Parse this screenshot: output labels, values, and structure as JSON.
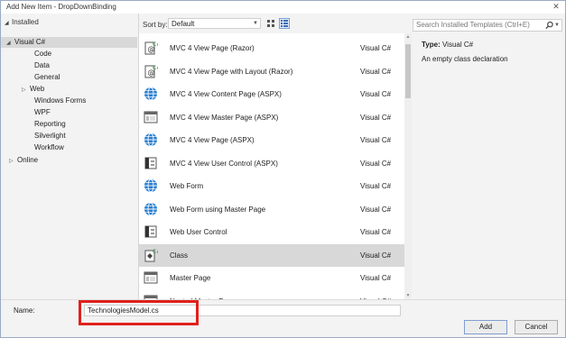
{
  "window": {
    "title": "Add New Item - DropDownBinding",
    "close_glyph": "✕"
  },
  "tree": {
    "header": "Installed",
    "selected": "Visual C#",
    "children": [
      "Code",
      "Data",
      "General",
      "Web",
      "Windows Forms",
      "WPF",
      "Reporting",
      "Silverlight",
      "Workflow"
    ],
    "online": "Online"
  },
  "sort": {
    "label": "Sort by:",
    "value": "Default"
  },
  "templates": [
    {
      "name": "MVC 4 View Page (Razor)",
      "lang": "Visual C#",
      "icon": "razor-page-icon"
    },
    {
      "name": "MVC 4 View Page with Layout (Razor)",
      "lang": "Visual C#",
      "icon": "razor-page-icon"
    },
    {
      "name": "MVC 4 View Content Page (ASPX)",
      "lang": "Visual C#",
      "icon": "globe-icon"
    },
    {
      "name": "MVC 4 View Master Page (ASPX)",
      "lang": "Visual C#",
      "icon": "master-page-icon"
    },
    {
      "name": "MVC 4 View Page (ASPX)",
      "lang": "Visual C#",
      "icon": "globe-icon"
    },
    {
      "name": "MVC 4 View User Control (ASPX)",
      "lang": "Visual C#",
      "icon": "user-control-icon"
    },
    {
      "name": "Web Form",
      "lang": "Visual C#",
      "icon": "globe-icon"
    },
    {
      "name": "Web Form using Master Page",
      "lang": "Visual C#",
      "icon": "globe-icon"
    },
    {
      "name": "Web User Control",
      "lang": "Visual C#",
      "icon": "user-control-icon"
    },
    {
      "name": "Class",
      "lang": "Visual C#",
      "icon": "class-icon"
    },
    {
      "name": "Master Page",
      "lang": "Visual C#",
      "icon": "master-page-icon"
    },
    {
      "name": "Nested Master Page",
      "lang": "Visual C#",
      "icon": "master-page-icon"
    }
  ],
  "selected_index": 9,
  "search": {
    "placeholder": "Search Installed Templates (Ctrl+E)"
  },
  "details": {
    "type_label": "Type:",
    "type_value": "Visual C#",
    "description": "An empty class declaration"
  },
  "form": {
    "name_label": "Name:",
    "name_value": "TechnologiesModel.cs"
  },
  "buttons": {
    "add": "Add",
    "cancel": "Cancel"
  },
  "colors": {
    "selection": "#d8d8d8",
    "highlight": "#e0201b",
    "globe": "#2a7fd0"
  }
}
